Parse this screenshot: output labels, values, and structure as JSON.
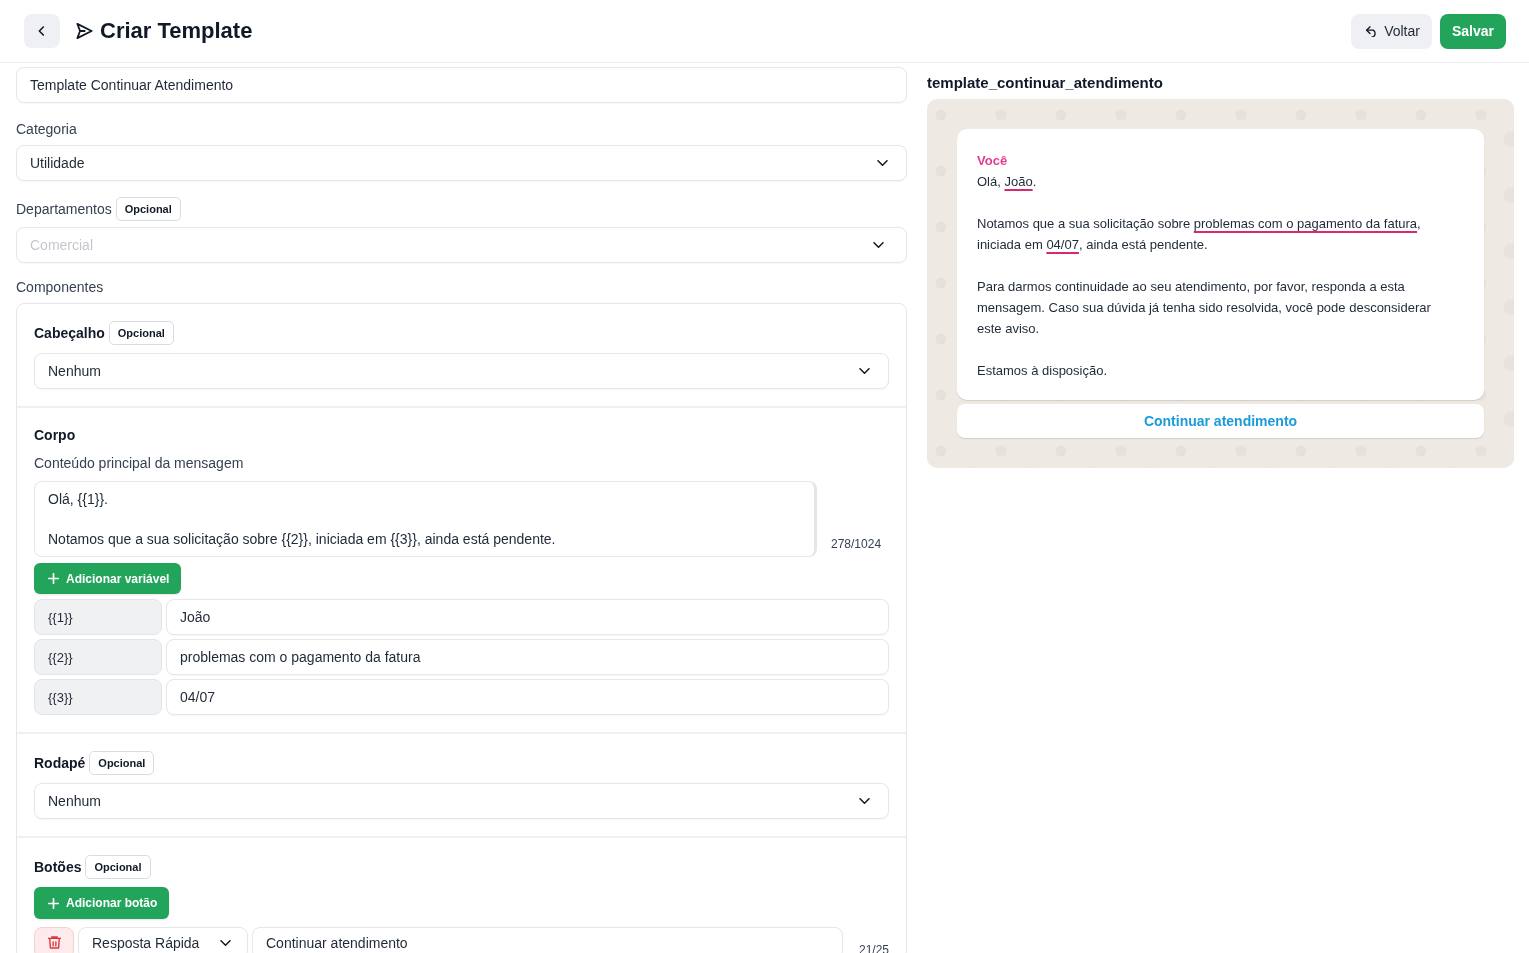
{
  "header": {
    "title": "Criar Template",
    "buttons": [
      {
        "label": "Voltar",
        "kind": "secondary"
      },
      {
        "label": "Salvar",
        "kind": "primary"
      }
    ]
  },
  "form": {
    "name": {
      "value": "Template Continuar Atendimento"
    },
    "category": {
      "label": "Categoria",
      "value": "Utilidade"
    },
    "departments": {
      "label": "Departamentos",
      "badge": "Opcional",
      "placeholder": "Comercial"
    },
    "components_label": "Componentes",
    "header_section": {
      "label": "Cabeçalho",
      "badge": "Opcional",
      "value": "Nenhum"
    },
    "body": {
      "label": "Corpo",
      "description": "Conteúdo principal da mensagem",
      "text": "Olá, {{1}}.\n\nNotamos que a sua solicitação sobre {{2}}, iniciada em {{3}}, ainda está pendente.",
      "counter": "278/1024",
      "add_button": "Adicionar variável",
      "variables": [
        {
          "key": "{{1}}",
          "value": "João"
        },
        {
          "key": "{{2}}",
          "value": "problemas com o pagamento da fatura"
        },
        {
          "key": "{{3}}",
          "value": "04/07"
        }
      ]
    },
    "footer_section": {
      "label": "Rodapé",
      "badge": "Opcional",
      "value": "Nenhum"
    },
    "buttons_section": {
      "label": "Botões",
      "badge": "Opcional",
      "add_button": "Adicionar botão",
      "items": [
        {
          "type": "Resposta Rápida",
          "text": "Continuar atendimento",
          "counter": "21/25"
        }
      ]
    }
  },
  "preview": {
    "template_name": "template_continuar_atendimento",
    "sender": "Você",
    "paragraphs": [
      {
        "segments": [
          {
            "text": "Olá, ",
            "variable": false
          },
          {
            "text": "João",
            "variable": true
          },
          {
            "text": ".",
            "variable": false
          }
        ]
      },
      {
        "segments": [
          {
            "text": "Notamos que a sua solicitação sobre ",
            "variable": false
          },
          {
            "text": "problemas com o pagamento da fatura",
            "variable": true
          },
          {
            "text": ", iniciada em ",
            "variable": false
          },
          {
            "text": "04/07",
            "variable": true
          },
          {
            "text": ", ainda está pendente.",
            "variable": false
          }
        ]
      },
      {
        "segments": [
          {
            "text": "Para darmos continuidade ao seu atendimento, por favor, responda a esta mensagem. Caso sua dúvida já tenha sido resolvida, você pode desconsiderar este aviso.",
            "variable": false
          }
        ]
      },
      {
        "segments": [
          {
            "text": "Estamos à disposição.",
            "variable": false
          }
        ]
      }
    ],
    "quick_replies": [
      "Continuar atendimento"
    ]
  }
}
